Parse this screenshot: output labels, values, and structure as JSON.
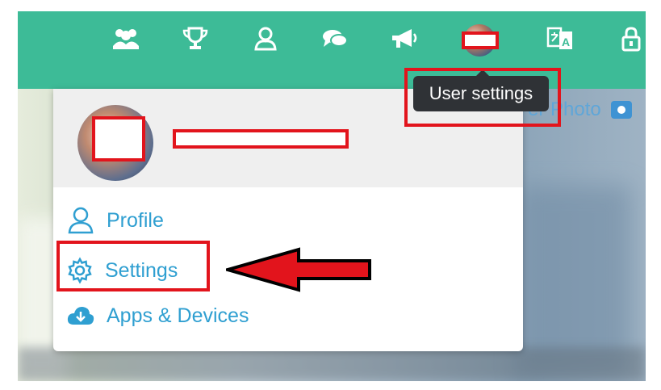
{
  "nav": {
    "icons": [
      "people-icon",
      "trophy-icon",
      "user-outline-icon",
      "chat-icon",
      "megaphone-icon",
      "avatar",
      "translate-icon",
      "lock-icon"
    ]
  },
  "tooltip": {
    "text": "User settings"
  },
  "cover": {
    "photo_label": "er Photo"
  },
  "menu": {
    "items": [
      {
        "label": "Profile",
        "icon": "user-icon"
      },
      {
        "label": "Settings",
        "icon": "gear-icon"
      },
      {
        "label": "Apps & Devices",
        "icon": "cloud-download-icon"
      }
    ]
  },
  "colors": {
    "topbar": "#3dbb97",
    "link": "#2f9fd1",
    "annotation_red": "#e2141c",
    "tooltip_bg": "#2f3236"
  }
}
